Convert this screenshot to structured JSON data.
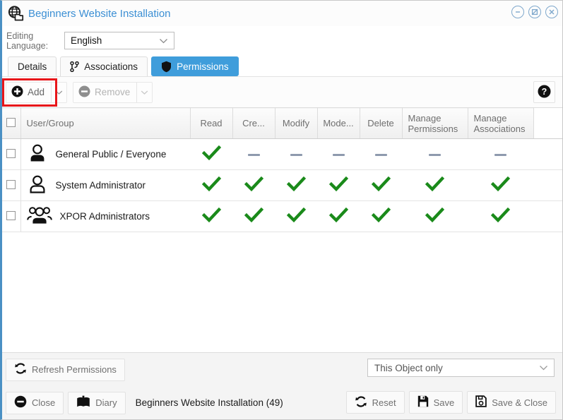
{
  "window": {
    "title": "Beginners Website Installation",
    "title_icon": "globe-page-icon",
    "controls": [
      {
        "name": "minimize-button",
        "glyph": "minus"
      },
      {
        "name": "restore-disabled-button",
        "glyph": "no-resize"
      },
      {
        "name": "close-button",
        "glyph": "times"
      }
    ]
  },
  "language": {
    "label": "Editing Language:",
    "value": "English"
  },
  "tabs": [
    {
      "label": "Details",
      "icon": null,
      "active": false
    },
    {
      "label": "Associations",
      "icon": "branch-icon",
      "active": false
    },
    {
      "label": "Permissions",
      "icon": "shield-icon",
      "active": true
    }
  ],
  "toolbar": {
    "add_label": "Add",
    "remove_label": "Remove",
    "help_label": "?",
    "highlight_color": "#e8161a"
  },
  "table": {
    "columns": [
      "User/Group",
      "Read",
      "Cre...",
      "Modify",
      "Mode...",
      "Delete",
      "Manage Permissions",
      "Manage Associations"
    ],
    "rows": [
      {
        "name": "General Public / Everyone",
        "icon": "user-icon",
        "permissions": [
          "check",
          "dash",
          "dash",
          "dash",
          "dash",
          "dash",
          "dash"
        ]
      },
      {
        "name": "System Administrator",
        "icon": "user-icon",
        "permissions": [
          "check",
          "check",
          "check",
          "check",
          "check",
          "check",
          "check"
        ]
      },
      {
        "name": "XPOR Administrators",
        "icon": "group-icon",
        "permissions": [
          "check",
          "check",
          "check",
          "check",
          "check",
          "check",
          "check"
        ]
      }
    ]
  },
  "footer": {
    "refresh_label": "Refresh Permissions",
    "scope_value": "This Object only",
    "close_label": "Close",
    "diary_label": "Diary",
    "status": "Beginners Website Installation (49)",
    "reset_label": "Reset",
    "save_label": "Save",
    "save_close_label": "Save & Close"
  },
  "colors": {
    "accent_blue": "#3f9ddb",
    "title_blue": "#3b8fd4",
    "check_green": "#1a8a1a",
    "dash_gray": "#8e9aae",
    "highlight_red": "#e8161a"
  }
}
